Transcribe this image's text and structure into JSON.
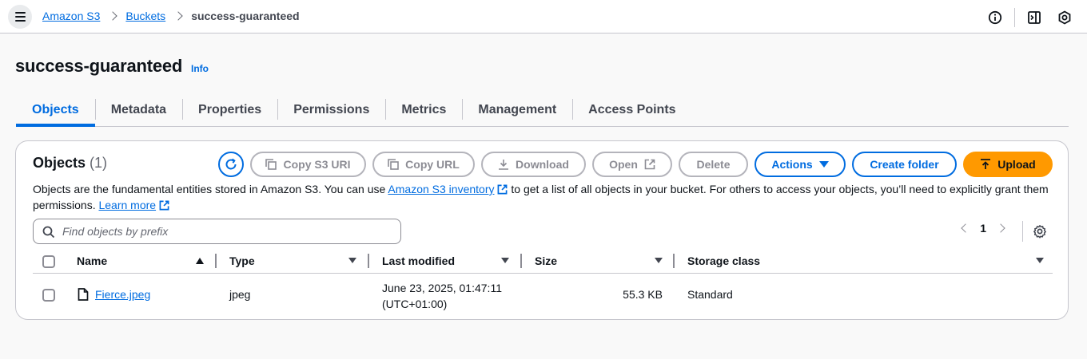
{
  "breadcrumb": {
    "items": [
      "Amazon S3",
      "Buckets"
    ],
    "current": "success-guaranteed"
  },
  "header_icons": [
    "info-circle-icon",
    "panel-icon",
    "settings-hex-icon"
  ],
  "page": {
    "title": "success-guaranteed",
    "info": "Info"
  },
  "tabs": [
    "Objects",
    "Metadata",
    "Properties",
    "Permissions",
    "Metrics",
    "Management",
    "Access Points"
  ],
  "objects": {
    "title": "Objects",
    "count": "(1)",
    "buttons": {
      "copy_uri": "Copy S3 URI",
      "copy_url": "Copy URL",
      "download": "Download",
      "open": "Open",
      "delete": "Delete",
      "actions": "Actions",
      "create_folder": "Create folder",
      "upload": "Upload"
    },
    "desc_1": "Objects are the fundamental entities stored in Amazon S3. You can use",
    "desc_link": "Amazon S3 inventory",
    "desc_2": "to get a list of all objects in your bucket. For others to access your objects, you’ll need to explicitly grant them permissions.",
    "learn_more": "Learn more",
    "search_placeholder": "Find objects by prefix",
    "page_number": "1",
    "columns": [
      "Name",
      "Type",
      "Last modified",
      "Size",
      "Storage class"
    ],
    "rows": [
      {
        "name": "Fierce.jpeg",
        "type": "jpeg",
        "modified_1": "June 23, 2025, 01:47:11",
        "modified_2": "(UTC+01:00)",
        "size": "55.3 KB",
        "storage": "Standard"
      }
    ]
  },
  "colors": {
    "accent": "#006ce0",
    "upload": "#ff9900",
    "border": "#c6c6cd"
  }
}
